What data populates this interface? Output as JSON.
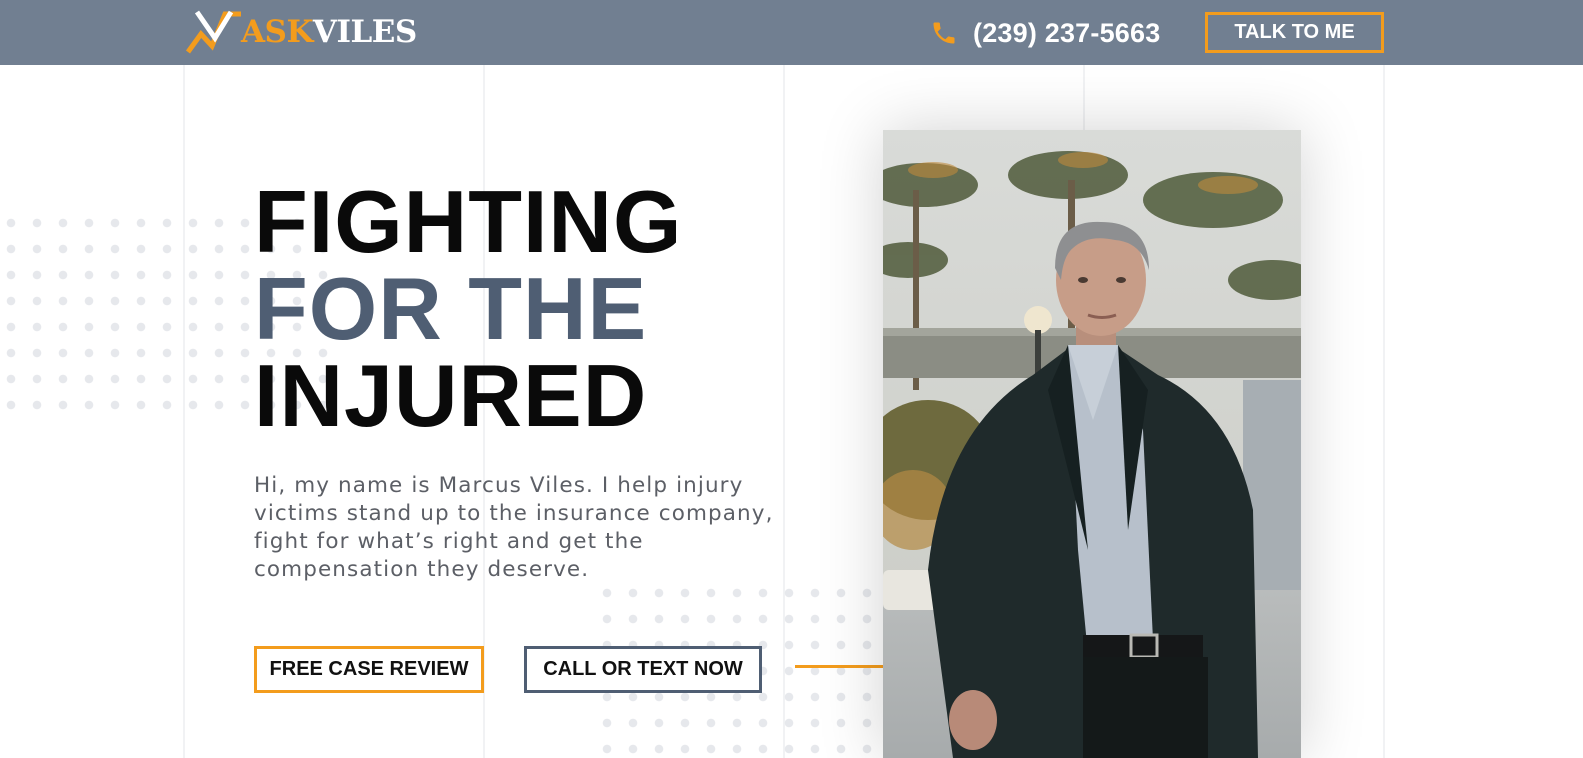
{
  "header": {
    "logo": {
      "ask": "ASK",
      "viles": "VILES"
    },
    "phone_number": "(239) 237-5663",
    "cta_label": "TALK TO ME"
  },
  "hero": {
    "headline": {
      "line1": "FIGHTING",
      "line2": "FOR THE",
      "line3": "INJURED"
    },
    "intro": "Hi, my name is Marcus Viles. I help injury victims stand up to the insurance company, fight for what’s right and get the compensation they deserve.",
    "buttons": {
      "review": "FREE CASE REVIEW",
      "call": "CALL OR TEXT NOW"
    }
  },
  "icons": {
    "phone": "phone-icon",
    "logo": "logo-mark-icon"
  },
  "colors": {
    "header_bg": "#717f91",
    "accent": "#f39c1d",
    "slate": "#4f5e73",
    "headline": "#0a0a0a"
  }
}
